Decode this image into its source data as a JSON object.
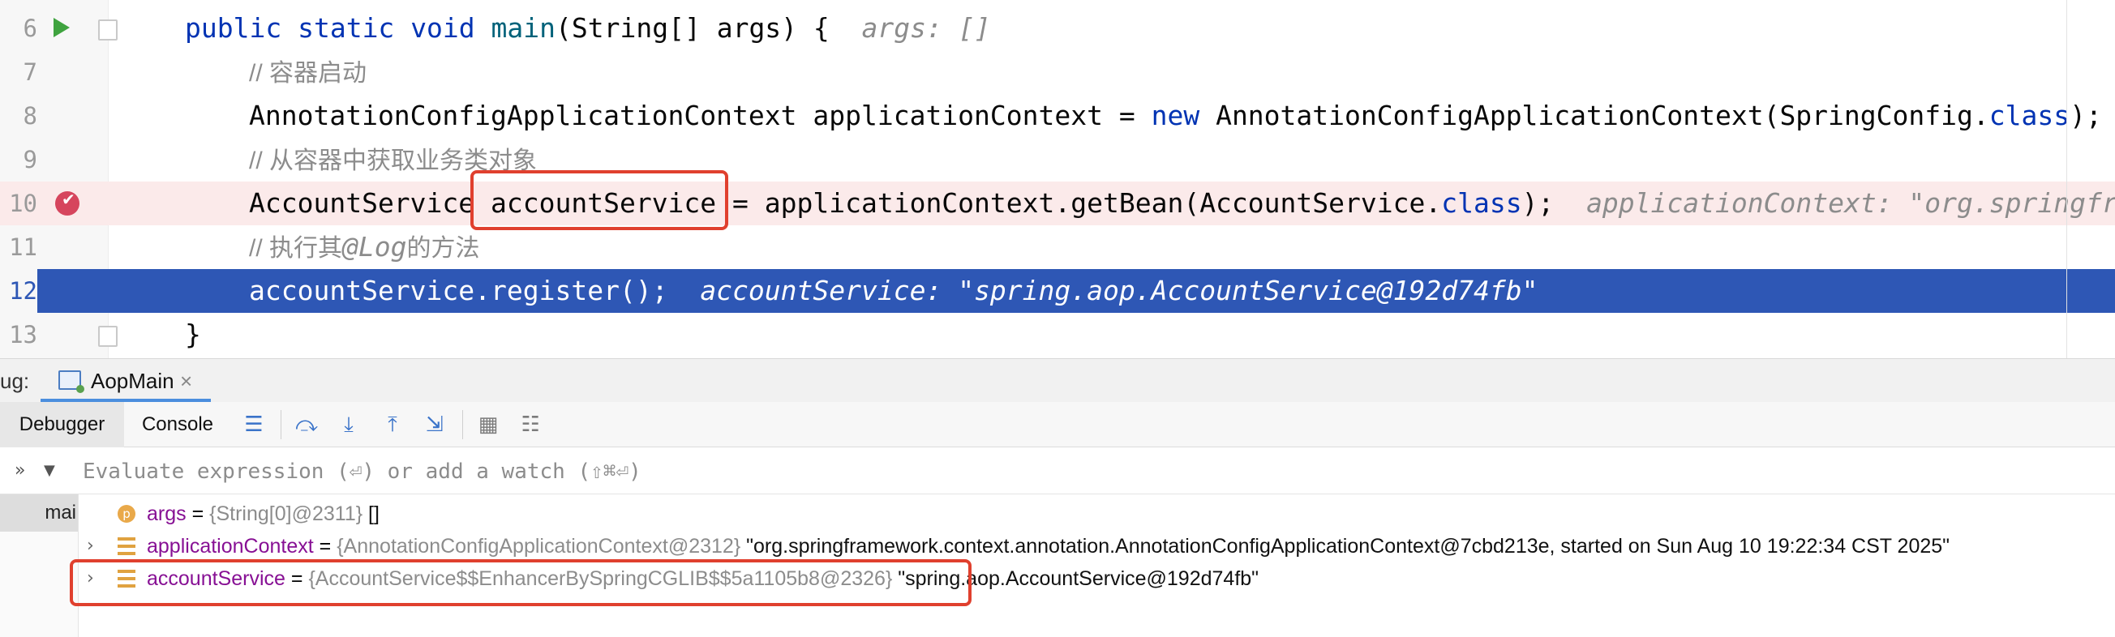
{
  "editor": {
    "lines": [
      {
        "n": "6"
      },
      {
        "n": "7"
      },
      {
        "n": "8"
      },
      {
        "n": "9"
      },
      {
        "n": "10"
      },
      {
        "n": "11"
      },
      {
        "n": "12"
      },
      {
        "n": "13"
      }
    ],
    "l6": {
      "k1": "public",
      "k2": "static",
      "k3": "void",
      "fn": "main",
      "rest": "(String[] args) {",
      "hint": "args: []"
    },
    "l7": {
      "comment": "// 容器启动"
    },
    "l8": {
      "a": "AnnotationConfigApplicationContext applicationContext = ",
      "kw": "new",
      "b": " AnnotationConfigApplicationContext(SpringConfig.",
      "kw2": "class",
      "c": ");"
    },
    "l9": {
      "comment": "// 从容器中获取业务类对象"
    },
    "l10": {
      "a": "AccountService accountService = applicationContext.getBean(AccountService.",
      "kw": "class",
      "b": ");",
      "hint": "applicationContext: \"org.springframework"
    },
    "l11": {
      "comment": "// 执行其",
      "annotation": "@Log",
      "comment2": "的方法"
    },
    "l12": {
      "code": "accountService.register();",
      "hint": "accountService: \"spring.aop.AccountService@192d74fb\""
    },
    "l13": {
      "code": "}"
    }
  },
  "debug": {
    "label": "ug:",
    "session_tab": "AopMain",
    "tabs": {
      "debugger": "Debugger",
      "console": "Console"
    }
  },
  "watch": {
    "placeholder": "Evaluate expression (⏎) or add a watch (⇧⌘⏎)",
    "collapse_glyph": "»",
    "dropdown_glyph": "▼"
  },
  "frames": {
    "selected": "mai"
  },
  "variables": [
    {
      "icon": "p",
      "name": "args",
      "eq": " = ",
      "type": "{String[0]@2311}",
      "value": " []"
    },
    {
      "icon": "field",
      "name": "applicationContext",
      "eq": " = ",
      "type": "{AnnotationConfigApplicationContext@2312}",
      "value": " \"org.springframework.context.annotation.AnnotationConfigApplicationContext@7cbd213e, started on Sun Aug 10 19:22:34 CST 2025\""
    },
    {
      "icon": "field",
      "name": "accountService",
      "eq": " = ",
      "type": "{AccountService$$EnhancerBySpringCGLIB$$5a1105b8@2326}",
      "value": " \"spring.aop.AccountService@192d74fb\""
    }
  ],
  "colors": {
    "accent": "#2e57b5",
    "highlight_box": "#e0402e",
    "breakpoint": "#d6455d"
  }
}
